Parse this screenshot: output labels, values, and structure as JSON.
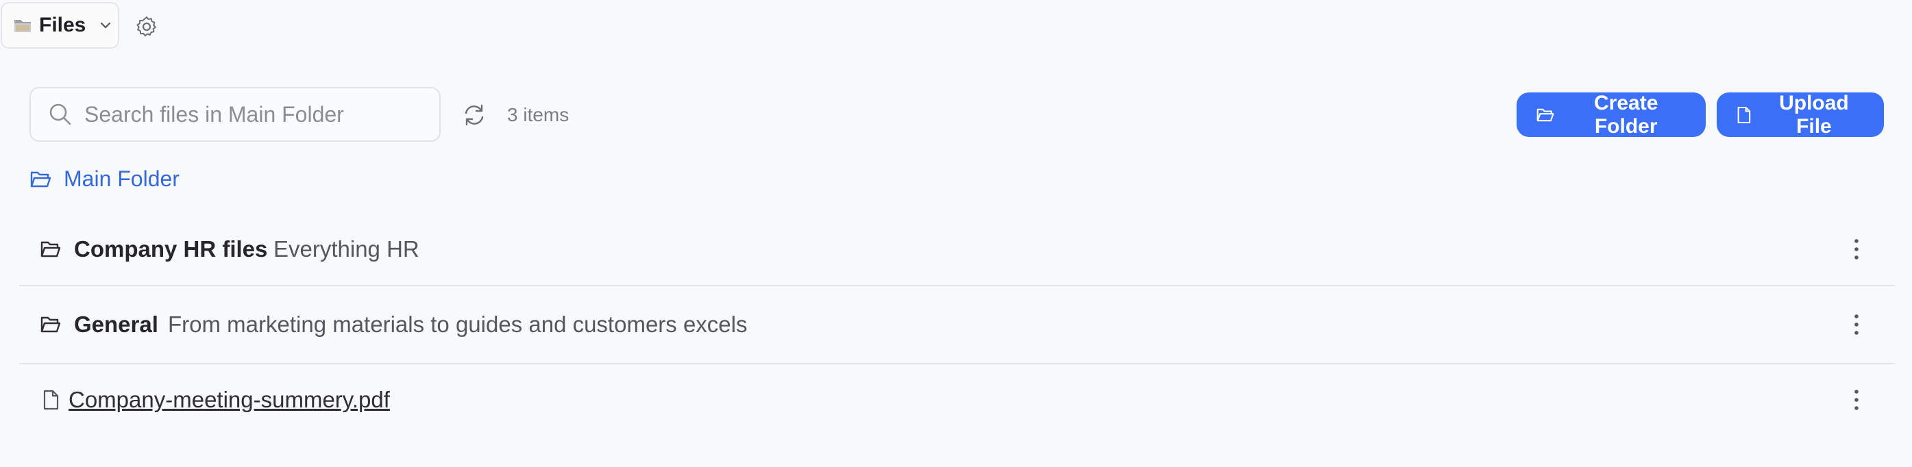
{
  "header": {
    "app_label": "Files",
    "folder_icon": "folder-emoji-icon",
    "settings_icon": "gear-icon"
  },
  "toolbar": {
    "search_placeholder": "Search files in Main Folder",
    "search_value": "",
    "item_count": "3 items",
    "create_folder_label": "Create Folder",
    "upload_file_label": "Upload File",
    "accent_color": "#3b6ff5"
  },
  "breadcrumb": {
    "current": "Main Folder"
  },
  "items": [
    {
      "type": "folder",
      "name": "Company HR files",
      "description": "Everything HR",
      "icon": "folder-open-icon"
    },
    {
      "type": "folder",
      "name": "General",
      "description": "From marketing materials to guides and customers excels",
      "icon": "folder-open-icon"
    },
    {
      "type": "file",
      "name": "Company-meeting-summery.pdf",
      "icon": "file-icon"
    }
  ]
}
